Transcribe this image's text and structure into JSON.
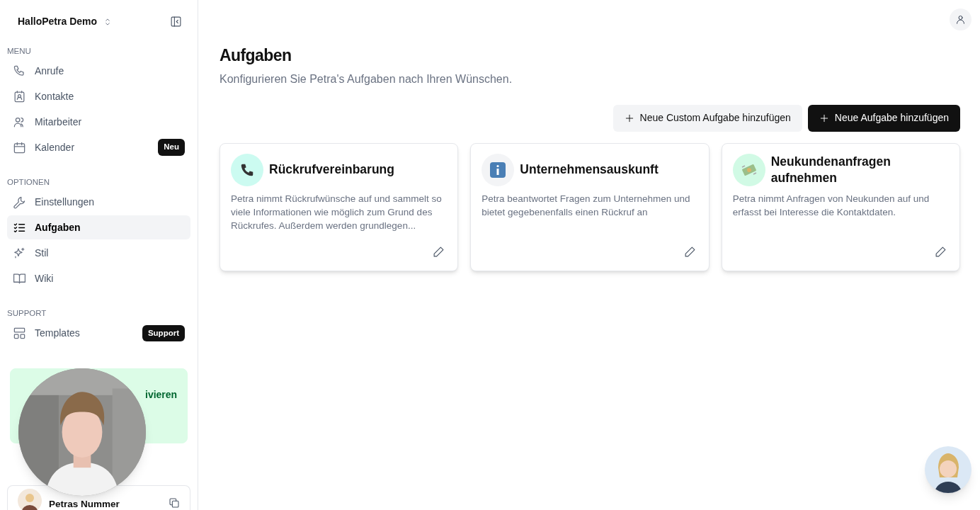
{
  "workspace": {
    "name": "HalloPetra Demo"
  },
  "sidebar": {
    "sections": [
      {
        "title": "MENU",
        "items": [
          {
            "label": "Anrufe",
            "kind": "phone",
            "selected": false
          },
          {
            "label": "Kontakte",
            "kind": "contact",
            "selected": false
          },
          {
            "label": "Mitarbeiter",
            "kind": "users",
            "selected": false
          },
          {
            "label": "Kalender",
            "kind": "calendar",
            "selected": false,
            "badge": "Neu"
          }
        ]
      },
      {
        "title": "OPTIONEN",
        "items": [
          {
            "label": "Einstellungen",
            "kind": "wrench",
            "selected": false
          },
          {
            "label": "Aufgaben",
            "kind": "list",
            "selected": true
          },
          {
            "label": "Stil",
            "kind": "sparkles",
            "selected": false
          },
          {
            "label": "Wiki",
            "kind": "book",
            "selected": false
          }
        ]
      },
      {
        "title": "SUPPORT",
        "items": [
          {
            "label": "Templates",
            "kind": "layout",
            "selected": false,
            "badge": "Support"
          }
        ]
      }
    ],
    "promo": {
      "text": "ivieren"
    },
    "phone_card": {
      "label": "Petras Nummer"
    }
  },
  "page": {
    "title": "Aufgaben",
    "subtitle": "Konfigurieren Sie Petra's Aufgaben nach Ihren Wünschen."
  },
  "buttons": [
    {
      "label": "Neue Custom Aufgabe hinzufügen",
      "kind": "secondary"
    },
    {
      "label": "Neue Aufgabe hinzufügen",
      "kind": "primary"
    }
  ],
  "tasks": [
    {
      "title": "Rückrufvereinbarung",
      "kind": "phone",
      "color": "#ccfbf1",
      "description": "Petra nimmt Rückrufwünsche auf und sammelt so viele Informationen wie möglich zum Grund des Rückrufes. Außerdem werden grundlegen..."
    },
    {
      "title": "Unternehmensauskunft",
      "kind": "info",
      "color": "#f3f4f6",
      "description": "Petra beantwortet Fragen zum Unternehmen und bietet gegebenenfalls einen Rückruf an"
    },
    {
      "title": "Neukundenanfragen aufnehmen",
      "kind": "money",
      "color": "#d1fae5",
      "description": "Petra nimmt Anfragen von Neukunden auf und erfasst bei Interesse die Kontaktdaten."
    }
  ]
}
